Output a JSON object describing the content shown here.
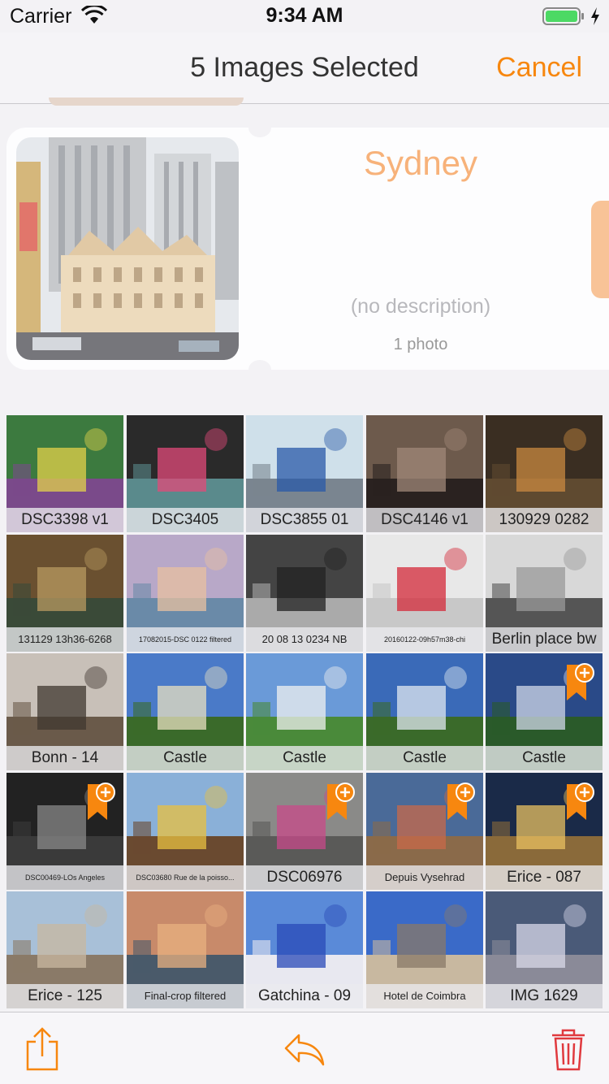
{
  "status_bar": {
    "carrier": "Carrier",
    "time": "9:34 AM"
  },
  "nav": {
    "title": "5 Images Selected",
    "cancel_label": "Cancel"
  },
  "album": {
    "title": "Sydney",
    "description": "(no description)",
    "photo_count": "1 photo"
  },
  "colors": {
    "accent": "#f7870f",
    "album_title": "#f7b27a"
  },
  "grid": {
    "photos": [
      {
        "caption": "DSC3398 v1",
        "size": "l",
        "selected": false,
        "sky": "#3c7a3f",
        "ground": "#7a4a8a",
        "accent": "#e3d24b"
      },
      {
        "caption": "DSC3405",
        "size": "l",
        "selected": false,
        "sky": "#2a2a2a",
        "ground": "#5a8a8c",
        "accent": "#e24a7a"
      },
      {
        "caption": "DSC3855 01",
        "size": "l",
        "selected": false,
        "sky": "#cfe0ea",
        "ground": "#7a8590",
        "accent": "#2a5aa8"
      },
      {
        "caption": "DSC4146 v1",
        "size": "l",
        "selected": false,
        "sky": "#6d5a4c",
        "ground": "#2a2220",
        "accent": "#a08878"
      },
      {
        "caption": "130929 0282",
        "size": "l",
        "selected": false,
        "sky": "#3a2e22",
        "ground": "#5f4a30",
        "accent": "#c98a40"
      },
      {
        "caption": "131129 13h36-6268",
        "size": "s",
        "selected": false,
        "sky": "#6a5030",
        "ground": "#3a4a38",
        "accent": "#b89a60"
      },
      {
        "caption": "17082015-DSC 0122 filtered",
        "size": "xs",
        "selected": false,
        "sky": "#b8a8c8",
        "ground": "#6a8aa8",
        "accent": "#e8c0a0"
      },
      {
        "caption": "20 08 13 0234 NB",
        "size": "s",
        "selected": false,
        "sky": "#444444",
        "ground": "#aaaaaa",
        "accent": "#222222"
      },
      {
        "caption": "20160122-09h57m38-chi",
        "size": "xs",
        "selected": false,
        "sky": "#e8e8e8",
        "ground": "#c8c8c8",
        "accent": "#d42a3a"
      },
      {
        "caption": "Berlin place bw",
        "size": "l",
        "selected": false,
        "sky": "#d8d8d8",
        "ground": "#555555",
        "accent": "#999999"
      },
      {
        "caption": "Bonn - 14",
        "size": "l",
        "selected": false,
        "sky": "#c8c0b8",
        "ground": "#6a5a4a",
        "accent": "#403830"
      },
      {
        "caption": "Castle",
        "size": "l",
        "selected": false,
        "sky": "#4a7ac8",
        "ground": "#3a6a2a",
        "accent": "#e8e0c0"
      },
      {
        "caption": "Castle",
        "size": "l",
        "selected": false,
        "sky": "#6a9ad8",
        "ground": "#4a8a3a",
        "accent": "#f0f0f0"
      },
      {
        "caption": "Castle",
        "size": "l",
        "selected": false,
        "sky": "#3a6ab8",
        "ground": "#3a6a2a",
        "accent": "#e0e8f0"
      },
      {
        "caption": "Castle",
        "size": "l",
        "selected": true,
        "sky": "#2a4a88",
        "ground": "#2a5a2a",
        "accent": "#d0d8e8"
      },
      {
        "caption": "DSC00469-LOs Angeles",
        "size": "xs",
        "selected": true,
        "sky": "#222222",
        "ground": "#3a3a3a",
        "accent": "#888888"
      },
      {
        "caption": "DSC03680 Rue de la poisso...",
        "size": "xs",
        "selected": false,
        "sky": "#8ab0d8",
        "ground": "#6a4a30",
        "accent": "#e8c040"
      },
      {
        "caption": "DSC06976",
        "size": "l",
        "selected": true,
        "sky": "#8a8a88",
        "ground": "#5a5a58",
        "accent": "#c84a8a"
      },
      {
        "caption": "Depuis Vysehrad",
        "size": "s",
        "selected": true,
        "sky": "#4a6a98",
        "ground": "#8a6a4a",
        "accent": "#c86a4a"
      },
      {
        "caption": "Erice - 087",
        "size": "l",
        "selected": true,
        "sky": "#1a2a48",
        "ground": "#8a6a3a",
        "accent": "#e8c060"
      },
      {
        "caption": "Erice - 125",
        "size": "l",
        "selected": false,
        "sky": "#a8c0d8",
        "ground": "#8a7a68",
        "accent": "#c8b8a0"
      },
      {
        "caption": "Final-crop filtered",
        "size": "s",
        "selected": false,
        "sky": "#c88a6a",
        "ground": "#4a5a6a",
        "accent": "#e8b080"
      },
      {
        "caption": "Gatchina - 09",
        "size": "l",
        "selected": false,
        "sky": "#5a8ad8",
        "ground": "#e8e8f0",
        "accent": "#2a4ab8"
      },
      {
        "caption": "Hotel de Coimbra",
        "size": "s",
        "selected": false,
        "sky": "#3a6ac8",
        "ground": "#c8b8a0",
        "accent": "#8a7a68"
      },
      {
        "caption": "IMG 1629",
        "size": "l",
        "selected": false,
        "sky": "#4a5a78",
        "ground": "#8a8a98",
        "accent": "#d8d8e8"
      }
    ]
  }
}
